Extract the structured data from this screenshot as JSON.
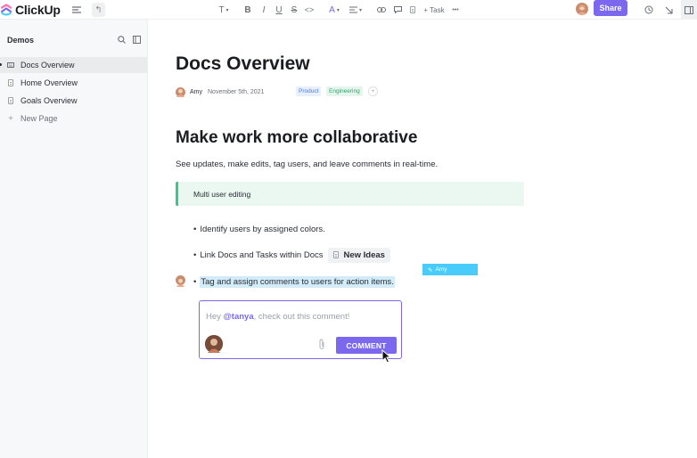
{
  "app": {
    "logo_text": "ClickUp",
    "accent_color": "#7b68ee"
  },
  "toolbar": {
    "text_format_label": "T",
    "task_label": "+ Task",
    "more_label": "•••",
    "share_label": "Share"
  },
  "sidebar": {
    "workspace_title": "Demos",
    "items": [
      {
        "label": "Docs Overview",
        "icon": "doc-icon",
        "active": true
      },
      {
        "label": "Home Overview",
        "icon": "doc-icon",
        "active": false
      },
      {
        "label": "Goals Overview",
        "icon": "doc-icon",
        "active": false
      }
    ],
    "new_page_label": "New Page"
  },
  "doc": {
    "title": "Docs Overview",
    "author": "Amy",
    "date": "November 5th, 2021",
    "tags": [
      "Product",
      "Engineering"
    ],
    "heading": "Make work more collaborative",
    "paragraph": "See updates, make edits, tag users, and leave comments in real-time.",
    "callout": "Multi user editing",
    "bullets": [
      "Identify users by assigned colors.",
      "Link Docs and Tasks within Docs",
      "Tag and assign comments to users for action items."
    ],
    "linked_doc_chip": "New Ideas",
    "cursor_user_label": "Amy"
  },
  "comment": {
    "prefix": "Hey ",
    "mention": "@tanya",
    "suffix": ", check out this comment!",
    "button_label": "COMMENT"
  }
}
